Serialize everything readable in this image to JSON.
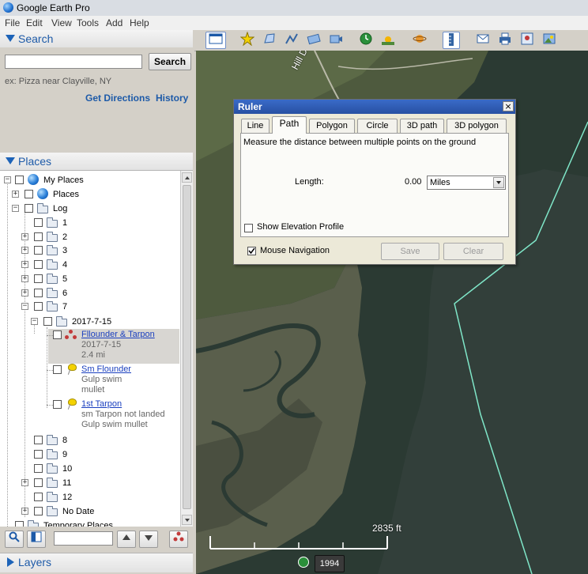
{
  "window": {
    "title": "Google Earth Pro"
  },
  "menu": [
    "File",
    "Edit",
    "View",
    "Tools",
    "Add",
    "Help"
  ],
  "search_panel": {
    "header": "Search",
    "input_value": "",
    "button": "Search",
    "hint": "ex: Pizza near Clayville, NY",
    "get_directions": "Get Directions",
    "history": "History"
  },
  "places_panel": {
    "header": "Places",
    "tree": {
      "my_places": "My Places",
      "places": "Places",
      "log": "Log",
      "folders_top": [
        "1",
        "2",
        "3",
        "4",
        "5",
        "6",
        "7"
      ],
      "date_folder": "2017-7-15",
      "items": [
        {
          "title": "Fllounder & Tarpon",
          "lines": [
            "2017-7-15",
            "2.4 mi"
          ]
        },
        {
          "title": "Sm Flounder",
          "lines": [
            "Gulp swim",
            "mullet"
          ]
        },
        {
          "title": "1st Tarpon",
          "lines": [
            "sm Tarpon not landed",
            "Gulp swim mullet"
          ]
        }
      ],
      "folders_bottom": [
        "8",
        "9",
        "10",
        "11",
        "12"
      ],
      "no_date": "No Date",
      "temporary_places": "Temporary Places"
    }
  },
  "layers_panel": {
    "header": "Layers"
  },
  "ruler": {
    "title": "Ruler",
    "tabs": [
      "Line",
      "Path",
      "Polygon",
      "Circle",
      "3D path",
      "3D polygon"
    ],
    "active_tab": "Path",
    "description": "Measure the distance between multiple points on the ground",
    "length_label": "Length:",
    "length_value": "0.00",
    "unit": "Miles",
    "show_elevation_label": "Show Elevation Profile",
    "show_elevation_checked": false,
    "mouse_navigation_label": "Mouse Navigation",
    "mouse_navigation_checked": true,
    "save_label": "Save",
    "clear_label": "Clear"
  },
  "map": {
    "road_label": "Hill Dr S",
    "scale_label": "2835 ft",
    "year": "1994"
  },
  "colors": {
    "accent_blue": "#1d5aa8",
    "title_blue": "#2850a3",
    "link_blue": "#1a3fbf",
    "boundary_line": "#7fe6c8"
  }
}
